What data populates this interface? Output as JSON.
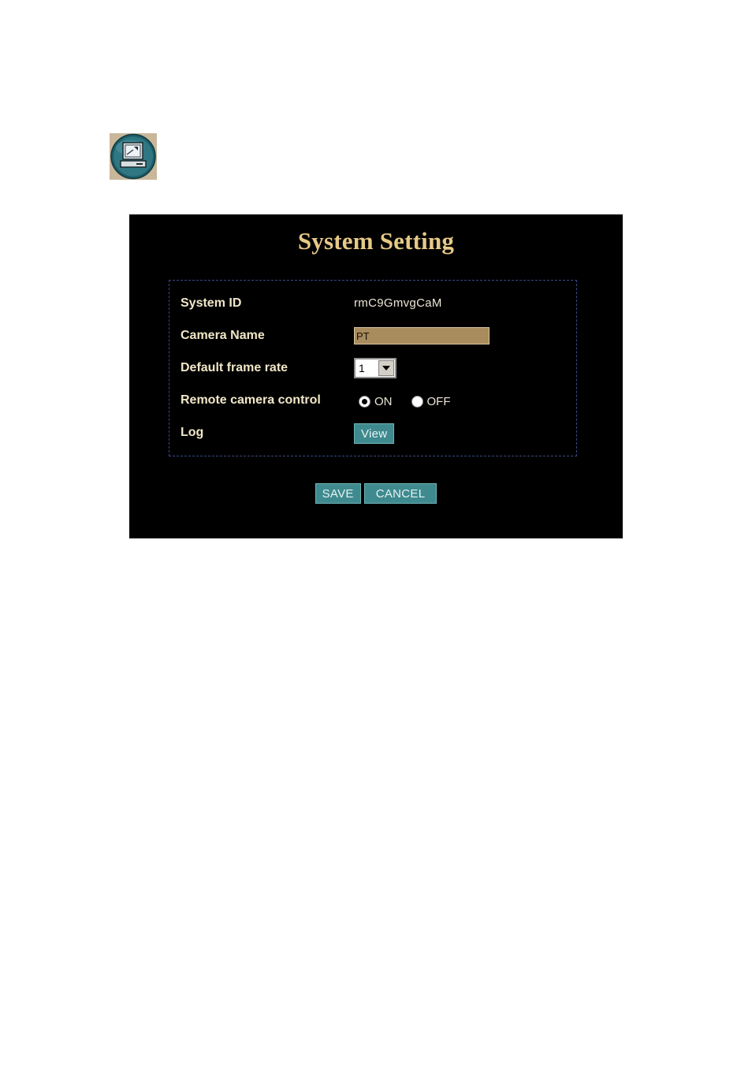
{
  "icons": {
    "app_icon": "computer-monitor-icon"
  },
  "colors": {
    "panel_background": "#000000",
    "title_color": "#e6c987",
    "label_color": "#f1e7c8",
    "button_color": "#3f8a8f",
    "input_background": "#a88c5e"
  },
  "panel": {
    "title": "System Setting"
  },
  "settings": {
    "system_id": {
      "label": "System ID",
      "value": "rmC9GmvgCaM"
    },
    "camera_name": {
      "label": "Camera Name",
      "value": "PT"
    },
    "default_frame_rate": {
      "label": "Default frame rate",
      "selected": "1"
    },
    "remote_camera_control": {
      "label": "Remote camera control",
      "on_label": "ON",
      "off_label": "OFF",
      "selected": "ON"
    },
    "log": {
      "label": "Log",
      "view_label": "View"
    }
  },
  "footer": {
    "save_label": "SAVE",
    "cancel_label": "CANCEL"
  }
}
